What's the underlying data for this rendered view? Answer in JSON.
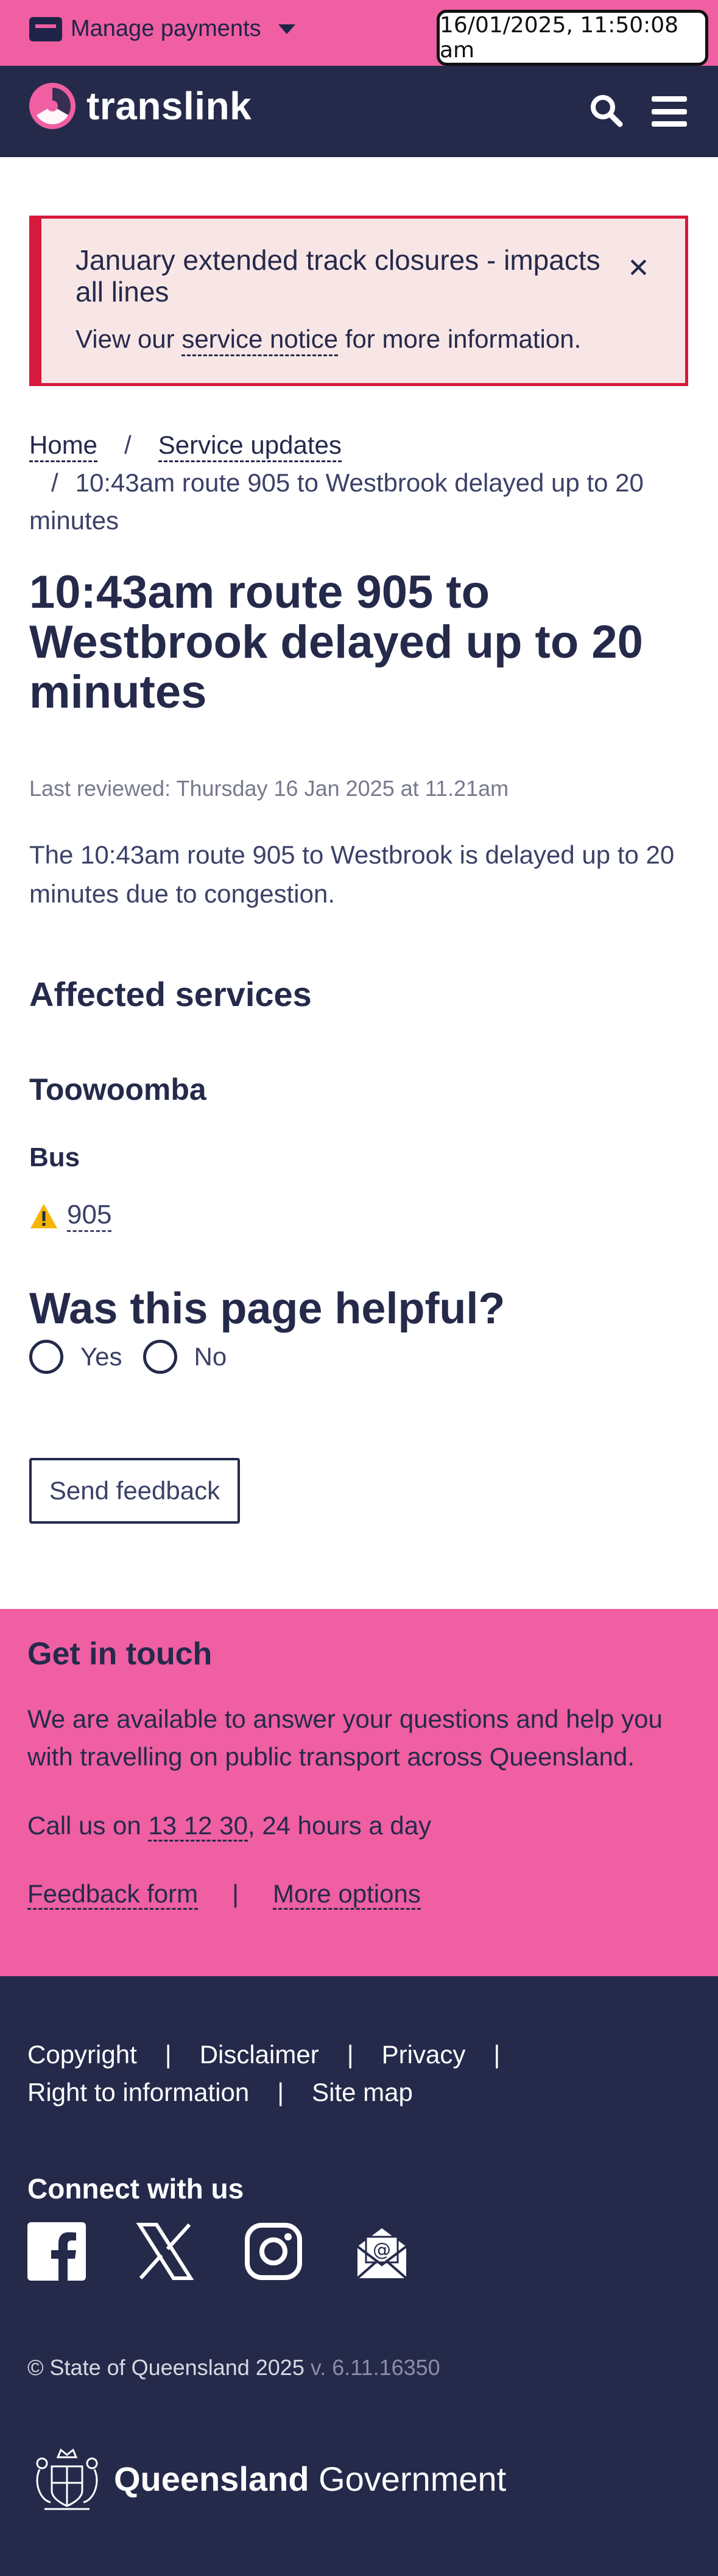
{
  "topbar": {
    "manage_label": "Manage payments",
    "timestamp": "16/01/2025, 11:50:08 am"
  },
  "nav": {
    "brand": "translink"
  },
  "alert": {
    "title": "January extended track closures - impacts all lines",
    "body_prefix": "View our ",
    "body_link": "service notice",
    "body_suffix": " for more information."
  },
  "breadcrumb": {
    "home": "Home",
    "service_updates": "Service updates",
    "current": "10:43am route 905 to Westbrook delayed up to 20 minutes",
    "separator": "/"
  },
  "page": {
    "title": "10:43am route 905 to Westbrook delayed up to 20 minutes",
    "last_reviewed": "Last reviewed: Thursday 16 Jan 2025 at 11.21am",
    "description": "The 10:43am route 905 to Westbrook is delayed up to 20 minutes due to congestion."
  },
  "affected": {
    "heading": "Affected services",
    "region": "Toowoomba",
    "mode": "Bus",
    "route": "905"
  },
  "feedback": {
    "question": "Was this page helpful?",
    "yes": "Yes",
    "no": "No",
    "send": "Send feedback"
  },
  "touch": {
    "title": "Get in touch",
    "text": "We are available to answer your questions and help you with travelling on public transport across Queensland.",
    "call_prefix": "Call us on ",
    "phone": "13 12 30",
    "call_suffix": ", 24 hours a day",
    "feedback_form": "Feedback form",
    "more_options": "More options",
    "separator": "|"
  },
  "footer": {
    "links": [
      "Copyright",
      "Disclaimer",
      "Privacy",
      "Right to information",
      "Site map"
    ],
    "separator": "|",
    "connect": "Connect with us",
    "copyright": "© State of Queensland 2025",
    "version": " v. 6.11.16350",
    "qld_bold": "Queensland",
    "qld_rest": " Government"
  },
  "colors": {
    "pink": "#ef5fa2",
    "navy": "#252a4b",
    "alert_red": "#d7193b",
    "alert_bg": "#f8e6e6"
  },
  "icons": [
    "card-icon",
    "caret-down-icon",
    "translink-logo-icon",
    "search-icon",
    "menu-icon",
    "close-icon",
    "warning-icon",
    "facebook-icon",
    "x-icon",
    "instagram-icon",
    "email-icon",
    "qld-coat-of-arms-icon"
  ]
}
